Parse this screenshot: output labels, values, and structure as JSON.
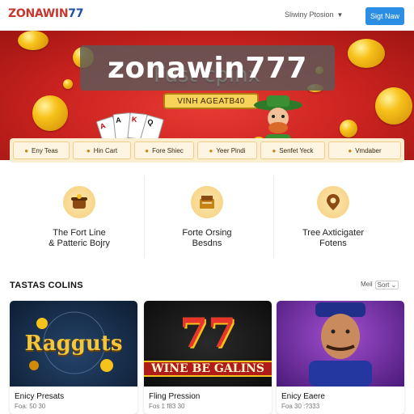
{
  "header": {
    "logo_part1": "ZONAWIN",
    "logo_part2": "77",
    "nav_label": "Sliwiny Ptosion",
    "signup_label": "Sigt Naw",
    "colors": {
      "brand_red": "#c8362e",
      "brand_blue": "#1f4fa8",
      "signup_bg": "#2b8de3"
    }
  },
  "overlay_title": "zonawin777",
  "hero": {
    "title": "Fust cpinx",
    "cta_label": "VINH AGEATB40",
    "cards": [
      "A",
      "A",
      "K",
      "Q"
    ],
    "colors": {
      "bg": "#c9221f",
      "cta": "#f7d35a"
    }
  },
  "tabs": [
    {
      "label": "Eny Teas",
      "icon": "coin-icon"
    },
    {
      "label": "Hin Cart",
      "icon": "coin-icon"
    },
    {
      "label": "Fore Shiec",
      "icon": "coin-icon"
    },
    {
      "label": "Yeer Pindi",
      "icon": "coin-icon"
    },
    {
      "label": "Senfet Yeck",
      "icon": "coin-icon"
    },
    {
      "label": "Vmdaber",
      "icon": "coin-icon"
    }
  ],
  "features": [
    {
      "label": "The Fort Line\n& Patteric Bojry",
      "icon": "pot-icon"
    },
    {
      "label": "Forte Orsing\nBesdns",
      "icon": "box-icon"
    },
    {
      "label": "Tree Axticigater\nFotens",
      "icon": "location-icon"
    }
  ],
  "section": {
    "title": "TASTAS COLINS",
    "sort_label": "Meil",
    "sort_value": "Sort"
  },
  "games": [
    {
      "title": "Ragguts",
      "name": "Enicy Presats",
      "meta": "Foa: 50 30"
    },
    {
      "title": "WINE BE GALINS",
      "badge": "77",
      "name": "Fling Pression",
      "meta": "Fos 1 f83 30"
    },
    {
      "title": "",
      "name": "Enicy Eaere",
      "meta": "Foa  30 :?333"
    }
  ]
}
